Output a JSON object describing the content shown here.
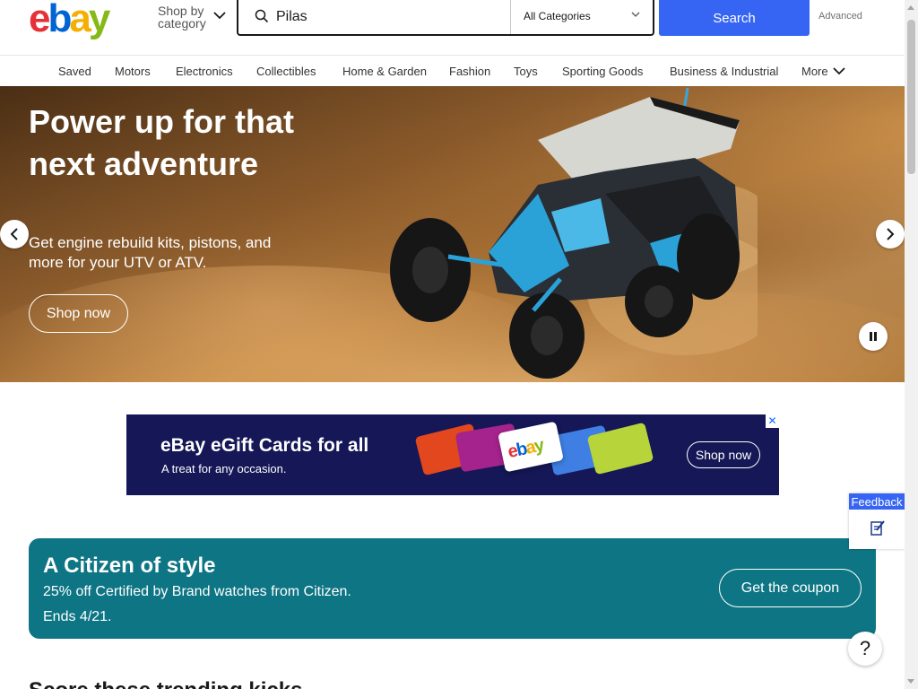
{
  "header": {
    "logo_text": "ebay",
    "shop_by_line1": "Shop by",
    "shop_by_line2": "category",
    "search_value": "Pilas",
    "category_selected": "All Categories",
    "search_button": "Search",
    "advanced_link": "Advanced"
  },
  "nav": {
    "items": [
      "Saved",
      "Motors",
      "Electronics",
      "Collectibles",
      "Home & Garden",
      "Fashion",
      "Toys",
      "Sporting Goods",
      "Business & Industrial",
      "More"
    ]
  },
  "hero": {
    "title": "Power up for that next adventure",
    "subtitle": "Get engine rebuild kits, pistons, and more for your UTV or ATV.",
    "button": "Shop now"
  },
  "ad": {
    "title": "eBay eGift Cards for all",
    "subtitle": "A treat for any occasion.",
    "button": "Shop now",
    "card_logo": "ebay",
    "close": "✕"
  },
  "promo": {
    "title": "A Citizen of style",
    "line1": "25% off Certified by Brand watches from Citizen.",
    "line2": "Ends 4/21.",
    "button": "Get the coupon"
  },
  "trending": {
    "heading": "Score these trending kicks"
  },
  "feedback": {
    "label": "Feedback"
  },
  "help": {
    "label": "?"
  },
  "colors": {
    "ebay_red": "#e53238",
    "ebay_blue": "#0064d2",
    "ebay_yellow": "#f5af02",
    "ebay_green": "#86b817",
    "search_button": "#3665f3",
    "ad_background": "#151757",
    "promo_background": "#0e7584"
  }
}
